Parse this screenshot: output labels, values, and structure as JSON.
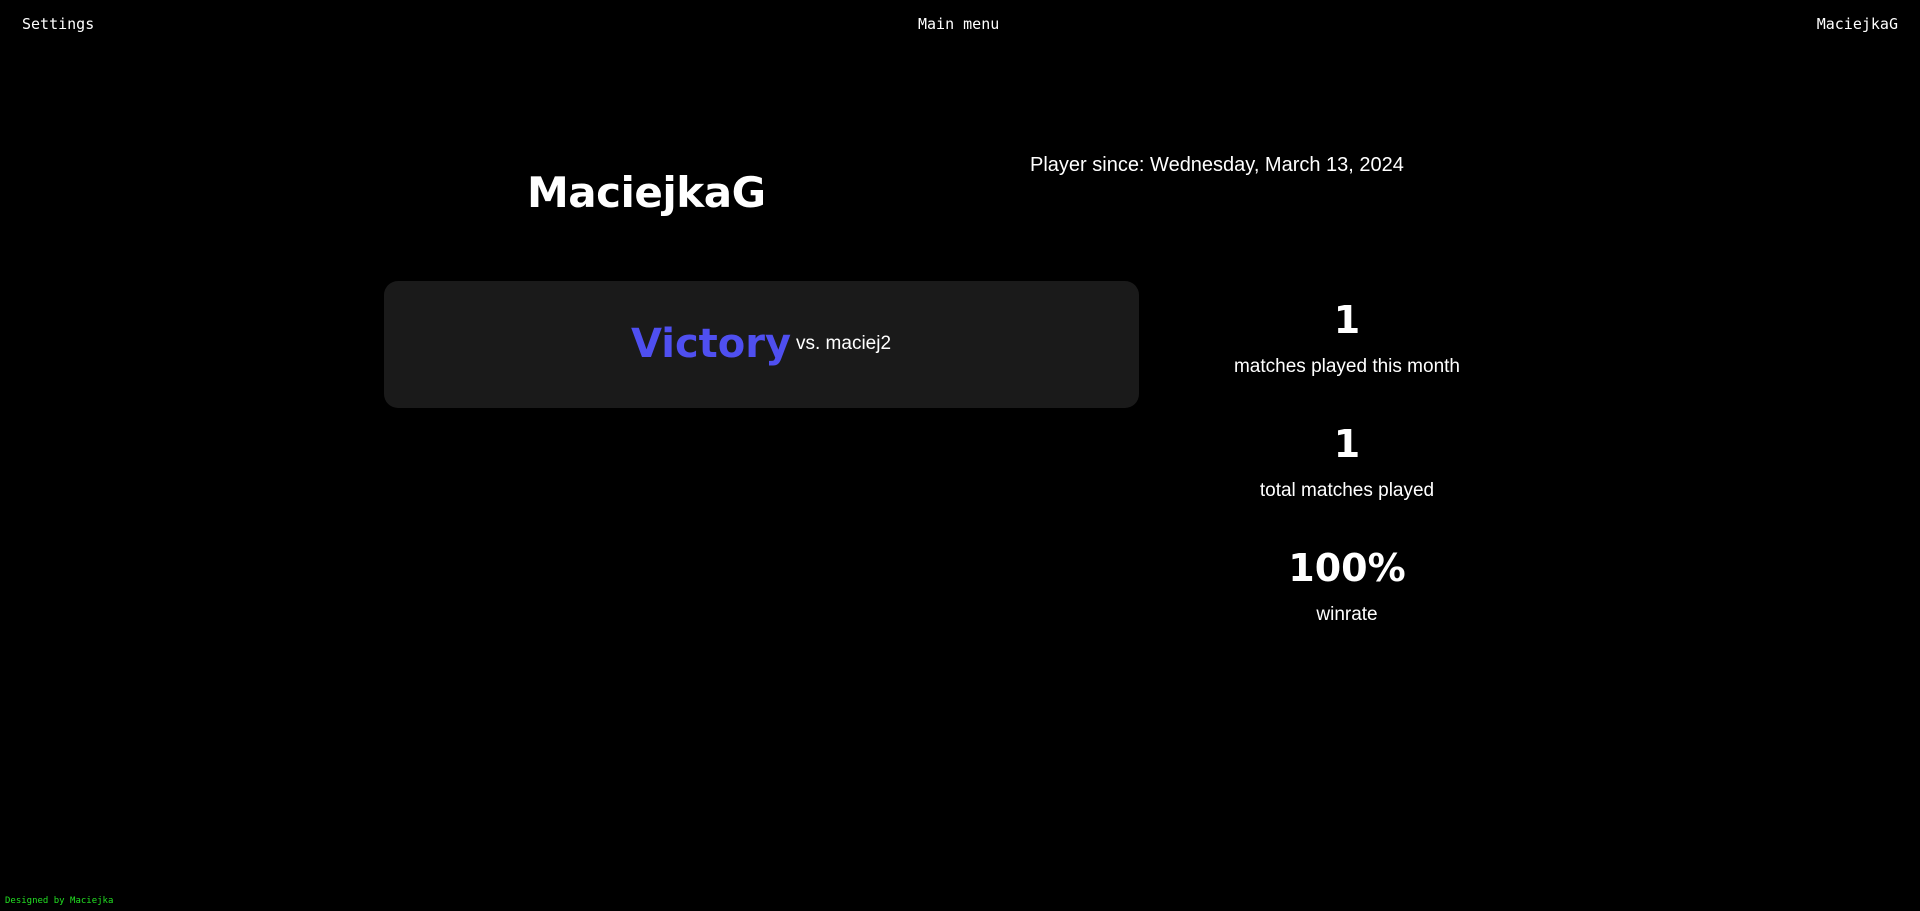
{
  "nav": {
    "settings_label": "Settings",
    "main_menu_label": "Main menu",
    "user_label": "MaciejkaG"
  },
  "profile": {
    "username": "MaciejkaG",
    "player_since": "Player since: Wednesday, March 13, 2024"
  },
  "matches": [
    {
      "result": "Victory",
      "opponent": "vs. maciej2"
    }
  ],
  "stats": [
    {
      "value": "1",
      "label": "matches played this month"
    },
    {
      "value": "1",
      "label": "total matches played"
    },
    {
      "value": "100%",
      "label": "winrate"
    }
  ],
  "footer": {
    "text": "Designed by Maciejka"
  },
  "colors": {
    "background": "#000000",
    "card": "#1a1a1a",
    "victory": "#4f4ff0",
    "footer": "#22e022"
  }
}
